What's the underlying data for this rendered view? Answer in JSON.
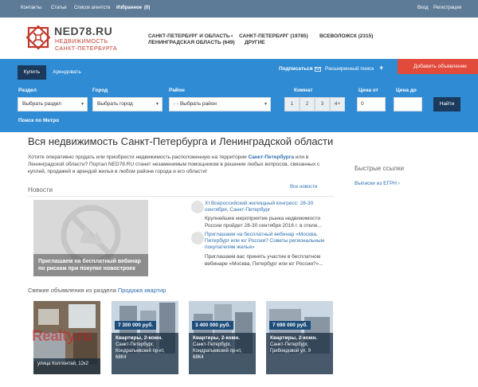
{
  "topbar": {
    "contacts": "Контакты",
    "articles": "Статьи",
    "agencies": "Список агентств",
    "favorites": "Избранное",
    "favorites_count": "(0)",
    "login": "Вход",
    "register": "Регистрация"
  },
  "header": {
    "logo_title": "NED78.RU",
    "logo_sub_1": "НЕДВИЖИМОСТЬ",
    "logo_sub_2": "САНКТ-ПЕТЕРБУРГА",
    "region_1": "Санкт-Петербург и область",
    "region_1_sub": "Ленинградская область (649)",
    "region_2": "Санкт-Петербург (19785)",
    "region_2_sub": "Другие",
    "region_3": "Всеволожск (2315)"
  },
  "search": {
    "tab_buy": "Купить",
    "tab_rent": "Арендовать",
    "subscribe": "Подписаться",
    "advanced": "Расширенный поиск",
    "add_ad": "Добавить объявление",
    "label_section": "Раздел",
    "label_city": "Город",
    "label_district": "Район",
    "label_rooms": "Комнат",
    "label_price_from": "Цена от",
    "label_price_to": "Цена до",
    "section_value": "Выбрать раздел",
    "city_value": "Выбрать город",
    "district_value": "- - Выбрать район",
    "rooms": [
      "1",
      "2",
      "3",
      "4+"
    ],
    "price_from_value": "0",
    "find": "Найти",
    "metro": "Поиск по Метро"
  },
  "main": {
    "title": "Вся недвижимость Санкт-Петербурга и Ленинградской области",
    "intro_1": "Хотите оперативно продать или приобрести недвижимость расположенную на территории",
    "intro_link": "Санкт-Петербурга",
    "intro_2": "или в Ленинградской области? Портал NED78.RU станет незаменимым помощником в решении любых вопросов, связанных с куплей, продажей и арендой жилья в любом районе города и его области!",
    "news_title": "Новости",
    "all_news": "Все новости",
    "news_image_caption": "Приглашаем на бесплатный вебинар по рискам при покупке новостроек",
    "news": [
      {
        "title": "XI Всероссийский жилищный конгресс: 28-30 сентября, Санкт-Петербург",
        "text": "Крупнейшее мероприятие рынка недвижимости России пройдет 28-30 сентября 2016 г. в отеле..."
      },
      {
        "title": "Приглашаем на бесплатный вебинар «Москва, Петербург или юг России? Советы региональным покупателям жилья»",
        "text": "Приглашаем вас принять участие в бесплатном вебинаре «Москва, Петербург или юг России?»..."
      }
    ],
    "fresh_label": "Свежие объявления из раздела",
    "fresh_link": "Продажа квартир"
  },
  "sidebar": {
    "quick_links_title": "Быстрые ссылки",
    "quick_link_1": "Выписки из ЕГРН ›"
  },
  "cards": [
    {
      "price": "",
      "type": "",
      "addr_1": "улица Коллонтай, 12к2",
      "addr_2": ""
    },
    {
      "price": "7 300 000 руб.",
      "type": "Квартиры, 2-комн.",
      "addr_1": "Санкт-Петербург,",
      "addr_2": "Кондратьевский пр-кт, 68К4"
    },
    {
      "price": "3 400 000 руб.",
      "type": "Квартиры, 2-комн.",
      "addr_1": "Санкт-Петербург,",
      "addr_2": "Кондратьевский пр-кт, 68К4"
    },
    {
      "price": "7 690 000 руб.",
      "type": "Квартиры, 2-комн.",
      "addr_1": "Санкт-Петербург,",
      "addr_2": "Грибоедовой ул, 9"
    }
  ],
  "watermark": "Realty.ru",
  "colors": {
    "topbar": "#5d7a96",
    "search_bg": "#2f8bd4",
    "dark_navy": "#1b3a5c",
    "accent_red": "#e24a3b",
    "link": "#2f6fb0"
  }
}
